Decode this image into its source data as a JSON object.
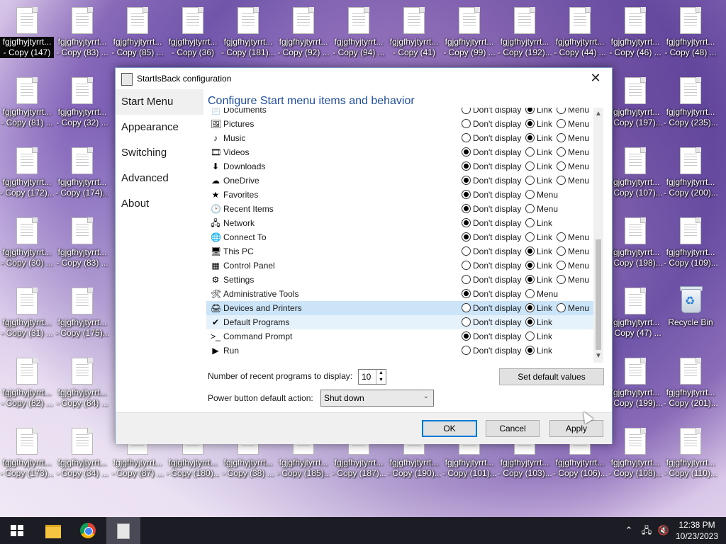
{
  "desktop": {
    "icons": [
      {
        "label": "fgjgfhyjtyrrt... - Copy (147)",
        "selected": true
      },
      {
        "label": "fgjgfhyjtyrrt... - Copy (83) ..."
      },
      {
        "label": "fgjgfhyjtyrrt... - Copy (85) ..."
      },
      {
        "label": "fgjgfhyjtyrrt... - Copy (36)"
      },
      {
        "label": "fgjgfhyjtyrrt... - Copy (181)..."
      },
      {
        "label": "fgjgfhyjtyrrt... - Copy (92) ..."
      },
      {
        "label": "fgjgfhyjtyrrt... - Copy (94) ..."
      },
      {
        "label": "fgjgfhyjtyrrt... - Copy (41)"
      },
      {
        "label": "fgjgfhyjtyrrt... - Copy (99) ..."
      },
      {
        "label": "fgjgfhyjtyrrt... - Copy (192)..."
      },
      {
        "label": "fgjgfhyjtyrrt... - Copy (44) ..."
      },
      {
        "label": "fgjgfhyjtyrrt... - Copy (46) ..."
      },
      {
        "label": "fgjgfhyjtyrrt... - Copy (48) ..."
      },
      {
        "label": "fgjgfhyjtyrrt... - Copy (81) ..."
      },
      {
        "label": "fgjgfhyjtyrrt... - Copy (32) ..."
      },
      {
        "label": "fgjgfhyjtyrrt... - Copy (197)..."
      },
      {
        "label": "fgjgfhyjtyrrt... - Copy (235)..."
      },
      {
        "label": "fgjgfhyjtyrrt... - Copy (172)..."
      },
      {
        "label": "fgjgfhyjtyrrt... - Copy (174)..."
      },
      {
        "label": "fgjgfhyjtyrrt... - Copy (107)..."
      },
      {
        "label": "fgjgfhyjtyrrt... - Copy (200)..."
      },
      {
        "label": "fgjgfhyjtyrrt... - Copy (30) ..."
      },
      {
        "label": "fgjgfhyjtyrrt... - Copy (83) ..."
      },
      {
        "label": "fgjgfhyjtyrrt... - Copy (198)..."
      },
      {
        "label": "fgjgfhyjtyrrt... - Copy (109)..."
      },
      {
        "label": "fgjgfhyjtyrrt... - Copy (31) ..."
      },
      {
        "label": "fgjgfhyjtyrrt... - Copy (175)..."
      },
      {
        "label": "fgjgfhyjtyrrt... - Copy (47) ..."
      },
      {
        "label": "Recycle Bin",
        "recycle": true
      },
      {
        "label": "fgjgfhyjtyrrt... - Copy (82) ..."
      },
      {
        "label": "fgjgfhyjtyrrt... - Copy (84) ..."
      },
      {
        "label": "fgjgfhyjtyrrt... - Copy (199)..."
      },
      {
        "label": "fgjgfhyjtyrrt... - Copy (201)..."
      },
      {
        "label": "fgjgfhyjtyrrt... - Copy (173)..."
      },
      {
        "label": "fgjgfhyjtyrrt... - Copy (34) ..."
      },
      {
        "label": "fgjgfhyjtyrrt... - Copy (87) ..."
      },
      {
        "label": "fgjgfhyjtyrrt... - Copy (180)..."
      },
      {
        "label": "fgjgfhyjtyrrt... - Copy (38) ..."
      },
      {
        "label": "fgjgfhyjtyrrt... - Copy (185)..."
      },
      {
        "label": "fgjgfhyjtyrrt... - Copy (187)..."
      },
      {
        "label": "fgjgfhyjtyrrt... - Copy (190)..."
      },
      {
        "label": "fgjgfhyjtyrrt... - Copy (101)..."
      },
      {
        "label": "fgjgfhyjtyrrt... - Copy (103)..."
      },
      {
        "label": "fgjgfhyjtyrrt... - Copy (106)..."
      },
      {
        "label": "fgjgfhyjtyrrt... - Copy (108)..."
      },
      {
        "label": "fgjgfhyjtyrrt... - Copy (110)..."
      }
    ]
  },
  "dialog": {
    "title": "StartIsBack configuration",
    "close_glyph": "✕",
    "nav": [
      {
        "label": "Start Menu",
        "active": true
      },
      {
        "label": "Appearance"
      },
      {
        "label": "Switching"
      },
      {
        "label": "Advanced"
      },
      {
        "label": "About"
      }
    ],
    "heading": "Configure Start menu items and behavior",
    "options": {
      "dont": "Don't display",
      "link": "Link",
      "menu": "Menu"
    },
    "items": [
      {
        "label": "Documents",
        "icon": "documents-icon",
        "glyph": "📄",
        "choices": [
          "dont",
          "link",
          "menu"
        ],
        "selected": "link"
      },
      {
        "label": "Pictures",
        "icon": "pictures-icon",
        "glyph": "🖼",
        "choices": [
          "dont",
          "link",
          "menu"
        ],
        "selected": "link"
      },
      {
        "label": "Music",
        "icon": "music-icon",
        "glyph": "♪",
        "choices": [
          "dont",
          "link",
          "menu"
        ],
        "selected": "link"
      },
      {
        "label": "Videos",
        "icon": "videos-icon",
        "glyph": "🎞",
        "choices": [
          "dont",
          "link",
          "menu"
        ],
        "selected": "dont"
      },
      {
        "label": "Downloads",
        "icon": "downloads-icon",
        "glyph": "⬇",
        "choices": [
          "dont",
          "link",
          "menu"
        ],
        "selected": "dont"
      },
      {
        "label": "OneDrive",
        "icon": "onedrive-icon",
        "glyph": "☁",
        "choices": [
          "dont",
          "link",
          "menu"
        ],
        "selected": "dont"
      },
      {
        "label": "Favorites",
        "icon": "favorites-icon",
        "glyph": "★",
        "choices": [
          "dont",
          "menu"
        ],
        "selected": "dont"
      },
      {
        "label": "Recent Items",
        "icon": "recent-items-icon",
        "glyph": "🕑",
        "choices": [
          "dont",
          "menu"
        ],
        "selected": "dont"
      },
      {
        "label": "Network",
        "icon": "network-icon",
        "glyph": "🖧",
        "choices": [
          "dont",
          "link"
        ],
        "selected": "dont"
      },
      {
        "label": "Connect To",
        "icon": "connect-to-icon",
        "glyph": "🌐",
        "choices": [
          "dont",
          "link",
          "menu"
        ],
        "selected": "dont"
      },
      {
        "label": "This PC",
        "icon": "this-pc-icon",
        "glyph": "🖥",
        "choices": [
          "dont",
          "link",
          "menu"
        ],
        "selected": "link"
      },
      {
        "label": "Control Panel",
        "icon": "control-panel-icon",
        "glyph": "▦",
        "choices": [
          "dont",
          "link",
          "menu"
        ],
        "selected": "link"
      },
      {
        "label": "Settings",
        "icon": "settings-icon",
        "glyph": "⚙",
        "choices": [
          "dont",
          "link",
          "menu"
        ],
        "selected": "link"
      },
      {
        "label": "Administrative Tools",
        "icon": "admin-tools-icon",
        "glyph": "🛠",
        "choices": [
          "dont",
          "menu"
        ],
        "selected": "dont"
      },
      {
        "label": "Devices and Printers",
        "icon": "devices-printers-icon",
        "glyph": "🖨",
        "choices": [
          "dont",
          "link",
          "menu"
        ],
        "selected": "link",
        "highlight": "sel"
      },
      {
        "label": "Default Programs",
        "icon": "default-programs-icon",
        "glyph": "✔",
        "choices": [
          "dont",
          "link"
        ],
        "selected": "link",
        "highlight": "hov"
      },
      {
        "label": "Command Prompt",
        "icon": "command-prompt-icon",
        "glyph": ">_",
        "choices": [
          "dont",
          "link"
        ],
        "selected": "dont"
      },
      {
        "label": "Run",
        "icon": "run-icon",
        "glyph": "▶",
        "choices": [
          "dont",
          "link"
        ],
        "selected": "link"
      }
    ],
    "recent_label": "Number of recent programs to display:",
    "recent_value": "10",
    "power_label": "Power button default action:",
    "power_value": "Shut down",
    "set_default": "Set default values",
    "ok": "OK",
    "cancel": "Cancel",
    "apply": "Apply"
  },
  "taskbar": {
    "time": "12:38 PM",
    "date": "10/23/2023"
  }
}
